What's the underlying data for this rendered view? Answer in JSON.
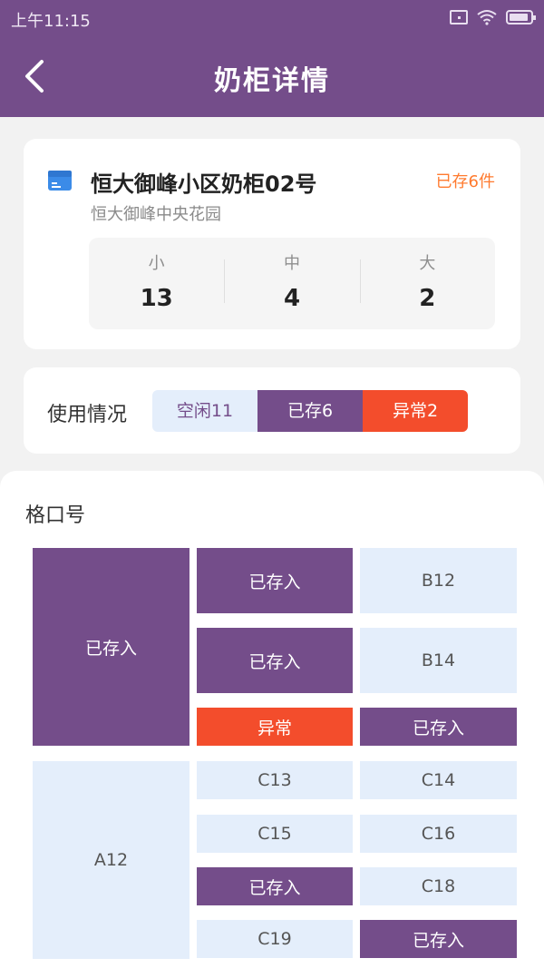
{
  "status_bar": {
    "time": "上午11:15"
  },
  "header": {
    "title": "奶柜详情"
  },
  "cabinet": {
    "name": "恒大御峰小区奶柜02号",
    "stored": "已存6件",
    "address": "恒大御峰中央花园",
    "sizes": [
      {
        "label": "小",
        "value": "13"
      },
      {
        "label": "中",
        "value": "4"
      },
      {
        "label": "大",
        "value": "2"
      }
    ]
  },
  "usage": {
    "label": "使用情况",
    "idle": "空闲11",
    "stored": "已存6",
    "abnormal": "异常2"
  },
  "slots": {
    "title": "格口号",
    "cells": [
      {
        "text": "已存入",
        "status": "stored"
      },
      {
        "text": "已存入",
        "status": "stored"
      },
      {
        "text": "B12",
        "status": "empty"
      },
      {
        "text": "已存入",
        "status": "stored"
      },
      {
        "text": "B14",
        "status": "empty"
      },
      {
        "text": "异常",
        "status": "abnormal"
      },
      {
        "text": "已存入",
        "status": "stored"
      },
      {
        "text": "A12",
        "status": "empty"
      },
      {
        "text": "C13",
        "status": "empty"
      },
      {
        "text": "C14",
        "status": "empty"
      },
      {
        "text": "C15",
        "status": "empty"
      },
      {
        "text": "C16",
        "status": "empty"
      },
      {
        "text": "已存入",
        "status": "stored"
      },
      {
        "text": "C18",
        "status": "empty"
      },
      {
        "text": "C19",
        "status": "empty"
      },
      {
        "text": "已存入",
        "status": "stored"
      }
    ]
  },
  "colors": {
    "primary": "#744d8a",
    "abnormal": "#f34d2c",
    "idle": "#e4eefb",
    "accent_orange": "#ff7a2e"
  }
}
